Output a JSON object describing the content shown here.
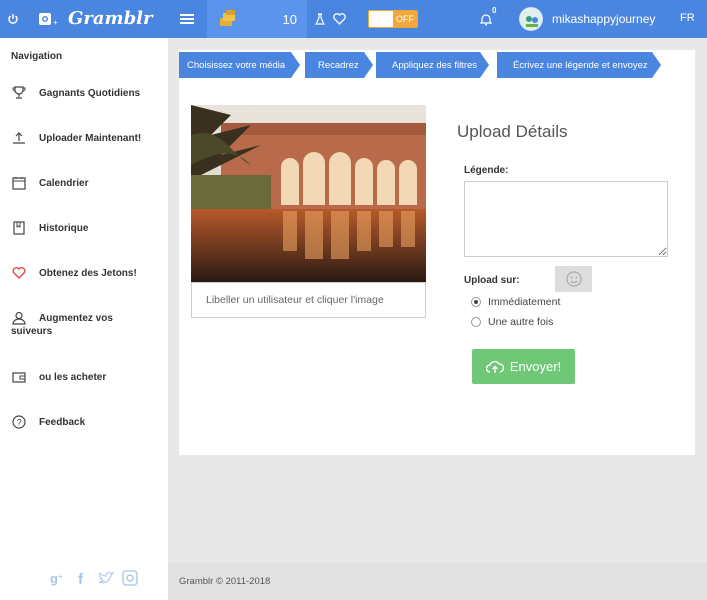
{
  "topbar": {
    "brand": "Gramblr",
    "coins": "10",
    "toggle_state": "OFF",
    "notifications": "0",
    "username": "mikashappyjourney",
    "language": "FR"
  },
  "sidebar": {
    "title": "Navigation",
    "items": [
      {
        "label": "Gagnants Quotidiens",
        "icon": "trophy-icon"
      },
      {
        "label": "Uploader Maintenant!",
        "icon": "upload-icon"
      },
      {
        "label": "Calendrier",
        "icon": "calendar-icon"
      },
      {
        "label": "Historique",
        "icon": "book-icon"
      },
      {
        "label": "Obtenez des Jetons!",
        "icon": "heart-icon"
      },
      {
        "label": "Augmentez vos",
        "label2": "suiveurs",
        "icon": "user-icon"
      },
      {
        "label": "ou les acheter",
        "icon": "wallet-icon"
      },
      {
        "label": "Feedback",
        "icon": "help-icon"
      }
    ],
    "social": [
      "google-plus-icon",
      "facebook-icon",
      "twitter-icon",
      "instagram-icon"
    ]
  },
  "steps": [
    "Choisissez votre média",
    "Recadrez",
    "Appliquez des filtres",
    "Écrivez une légende et envoyez"
  ],
  "main": {
    "tag_hint": "Libeller un utilisateur et cliquer l'image",
    "title": "Upload Détails",
    "legend_label": "Légende:",
    "caption_value": "",
    "upload_on_label": "Upload sur:",
    "options": [
      "Immédiatement",
      "Une autre fois"
    ],
    "selected_option": "Immédiatement",
    "send_label": "Envoyer!"
  },
  "footer": {
    "copyright": "Gramblr © 2011-2018"
  },
  "colors": {
    "primary": "#4a86e0",
    "toggle": "#f2a83a",
    "send": "#6fc777",
    "heart": "#e04a4a"
  }
}
